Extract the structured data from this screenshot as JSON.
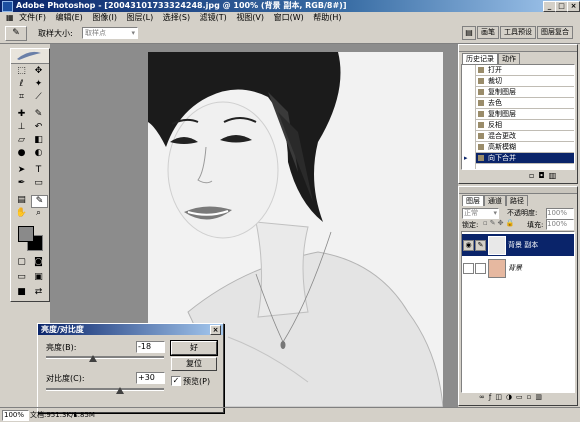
{
  "window": {
    "title": "Adobe Photoshop - [20043101733324248.jpg @ 100% (背景 副本, RGB/8#)]",
    "minimize": "_",
    "maximize": "□",
    "close": "×"
  },
  "menu": [
    "文件(F)",
    "编辑(E)",
    "图像(I)",
    "图层(L)",
    "选择(S)",
    "滤镜(T)",
    "视图(V)",
    "窗口(W)",
    "帮助(H)"
  ],
  "options": {
    "tool_icon": "eyedropper-icon",
    "sample_label": "取样大小:",
    "sample_value": "取样点",
    "tabs": [
      "画笔",
      "工具预设",
      "图层复合"
    ]
  },
  "history": {
    "tabs": [
      "历史记录",
      "动作"
    ],
    "items": [
      {
        "label": "打开"
      },
      {
        "label": "裁切"
      },
      {
        "label": "复制图层"
      },
      {
        "label": "去色"
      },
      {
        "label": "复制图层"
      },
      {
        "label": "反相"
      },
      {
        "label": "混合更改"
      },
      {
        "label": "高斯模糊"
      },
      {
        "label": "向下合并",
        "selected": true
      }
    ]
  },
  "layers": {
    "tabs": [
      "图层",
      "通道",
      "路径"
    ],
    "blend_mode": "正常",
    "opacity_label": "不透明度:",
    "opacity_value": "100%",
    "lock_label": "锁定:",
    "fill_label": "填充:",
    "fill_value": "100%",
    "items": [
      {
        "name": "背景 副本",
        "selected": true
      },
      {
        "name": "背景",
        "selected": false
      }
    ]
  },
  "dialog": {
    "title": "亮度/对比度",
    "brightness_label": "亮度(B):",
    "brightness_value": "-18",
    "contrast_label": "对比度(C):",
    "contrast_value": "+30",
    "ok_label": "好",
    "reset_label": "复位",
    "preview_label": "预览(P)",
    "preview_checked": true
  },
  "status": {
    "zoom": "100%",
    "doc_info": "文档:951.3K/1.85M"
  },
  "colors": {
    "title_bar": "#0a246a",
    "chrome": "#d4d0c8",
    "workspace": "#8c8c8c",
    "selection": "#0a246a"
  }
}
